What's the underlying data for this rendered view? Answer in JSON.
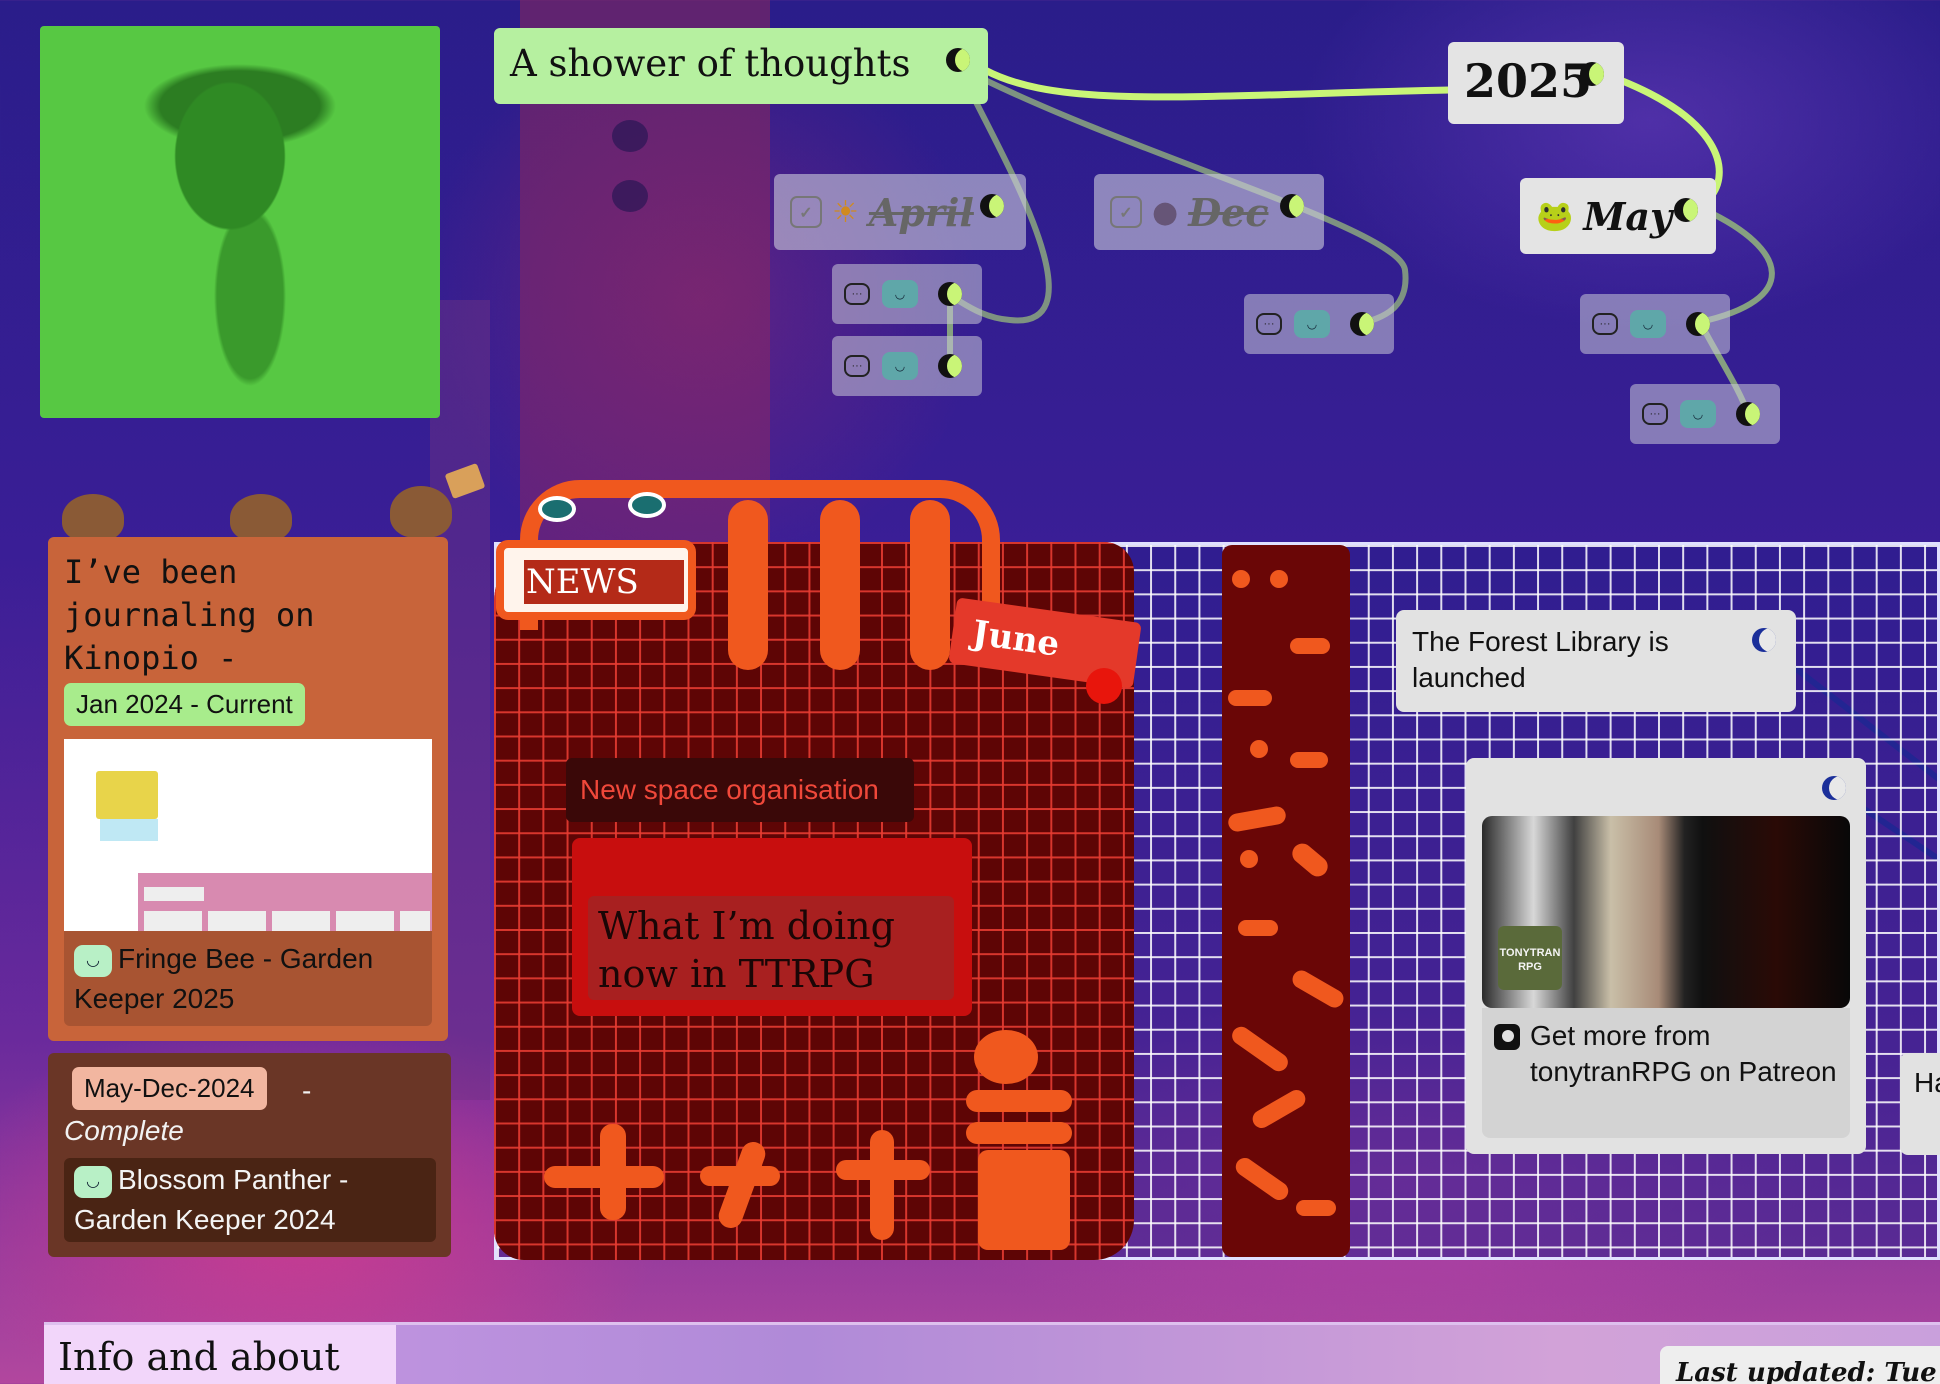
{
  "profile": {
    "alt": ""
  },
  "thoughts": {
    "title": "A shower of thoughts"
  },
  "year": {
    "label": "2025"
  },
  "months": {
    "april": {
      "icon": "☀",
      "label": "April",
      "checked": true,
      "struck": true
    },
    "dec": {
      "icon": "●",
      "label": "Dec",
      "checked": true,
      "struck": true
    },
    "may": {
      "icon": "🐸",
      "label": "May"
    }
  },
  "journal": {
    "title": "I’ve been journaling on Kinopio -",
    "period_tag": "Jan 2024 - Current",
    "keeper_card": "Fringe Bee - Garden Keeper 2025"
  },
  "archive": {
    "period_tag": "May-Dec-2024",
    "dash": "-",
    "status": "Complete",
    "keeper_card": "Blossom Panther - Garden Keeper 2024"
  },
  "news": {
    "label": "NEWS",
    "june_tag": "June",
    "space_org": "New space organisation",
    "ttrpg": "What I’m doing now in TTRPG"
  },
  "forest": {
    "text": "The Forest Library is launched"
  },
  "patreon": {
    "logo_text": "TONYTRAN RPG",
    "label": "Get more from tonytranRPG on Patreon"
  },
  "peek": {
    "text": "Ha Ha"
  },
  "footer": {
    "info_tab": "Info and about me",
    "last_updated": "Last updated: Tue M"
  },
  "colors": {
    "accent_green": "#c9f577",
    "card_bg": "#e4e4e4",
    "journal_orange": "#c8643a",
    "news_red": "#5e0505",
    "june_red": "#e4392a"
  },
  "icons": [
    "chat-icon",
    "face-icon",
    "moon-icon",
    "checkbox-icon",
    "patreon-icon",
    "dog-sticker-icon"
  ]
}
